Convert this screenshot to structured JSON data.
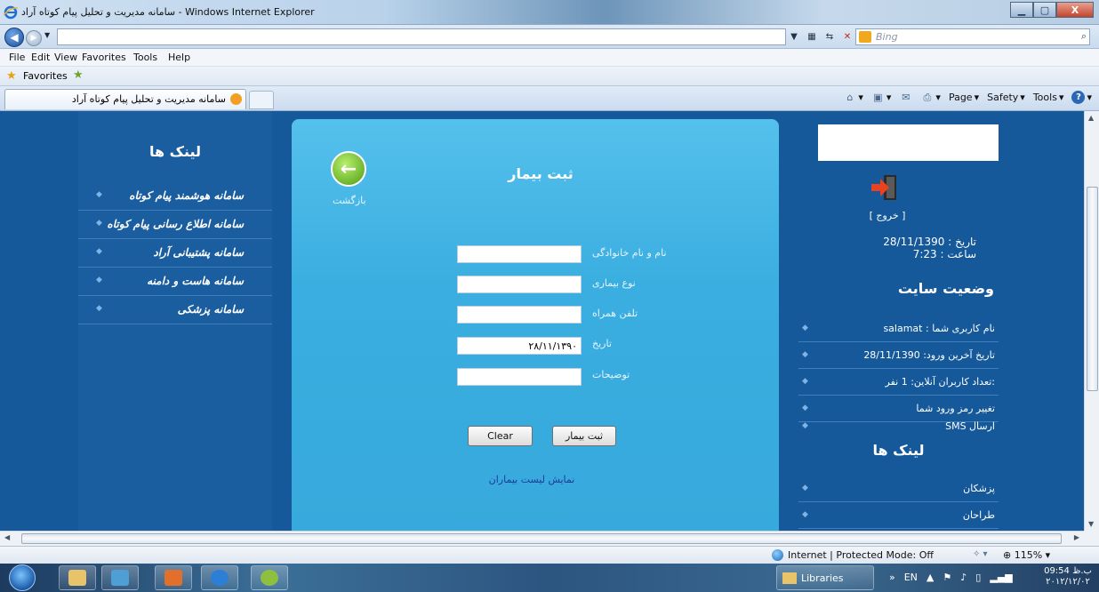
{
  "window": {
    "title": "سامانه مدیریت و تحلیل پیام کوتاه آراد - Windows Internet Explorer",
    "controls": {
      "minimize": "▁",
      "maximize": "▢",
      "close": "X"
    }
  },
  "address_bar": {
    "url": "",
    "search_placeholder": "Bing",
    "search_go": "⌕"
  },
  "menu": [
    "File",
    "Edit",
    "View",
    "Favorites",
    "Tools",
    "Help"
  ],
  "favorites_bar": {
    "label": "Favorites"
  },
  "tab": {
    "title": "سامانه مدیریت و تحلیل پیام کوتاه آراد"
  },
  "command_bar": {
    "page": "Page",
    "safety": "Safety",
    "tools": "Tools",
    "help": "?"
  },
  "left_links": {
    "title": "لینک ها",
    "items": [
      "سامانه هوشمند پیام کوتاه",
      "سامانه اطلاع رسانی پیام کوتاه",
      "سامانه پشتیبانی آراد",
      "سامانه هاست و دامنه",
      "سامانه پزشکی"
    ]
  },
  "form": {
    "back_label": "بازگشت",
    "title": "ثبت بیمار",
    "fields": [
      {
        "label": "نام و نام خانوادگی",
        "value": ""
      },
      {
        "label": "نوع بیماری",
        "value": ""
      },
      {
        "label": "تلفن همراه",
        "value": ""
      },
      {
        "label": "تاریخ",
        "value": "۲۸/۱۱/۱۳۹۰"
      },
      {
        "label": "توضیحات",
        "value": ""
      }
    ],
    "clear_button": "Clear",
    "submit_button": "ثبت بیمار",
    "list_link": "نمایش لیست بیماران"
  },
  "right_panel": {
    "exit_link": "[ خروج ]",
    "date_line": "تاریخ : 28/11/1390",
    "time_line": "ساعت : 7:23",
    "status_title": "وضعیت سایت",
    "status_items": [
      "نام کاربری شما : salamat",
      "تاریخ آخرین ورود: 28/11/1390",
      ":تعداد کاربران آنلاین: 1 نفر",
      "تغییر رمز ورود شما",
      "ارسال SMS"
    ],
    "links_title": "لینک ها",
    "link_items": [
      "پزشکان",
      "طراحان"
    ]
  },
  "status_bar": {
    "zone": "Internet | Protected Mode: Off",
    "zoom": "115%"
  },
  "taskbar": {
    "libraries": "Libraries",
    "lang": "EN",
    "time": "09:54 ب.ظ",
    "date": "۲۰۱۲/۱۲/۰۲"
  },
  "colors": {
    "page_bg": "#15599b",
    "panel_bg": "#3aaee0",
    "link_color": "#1a3c99"
  }
}
